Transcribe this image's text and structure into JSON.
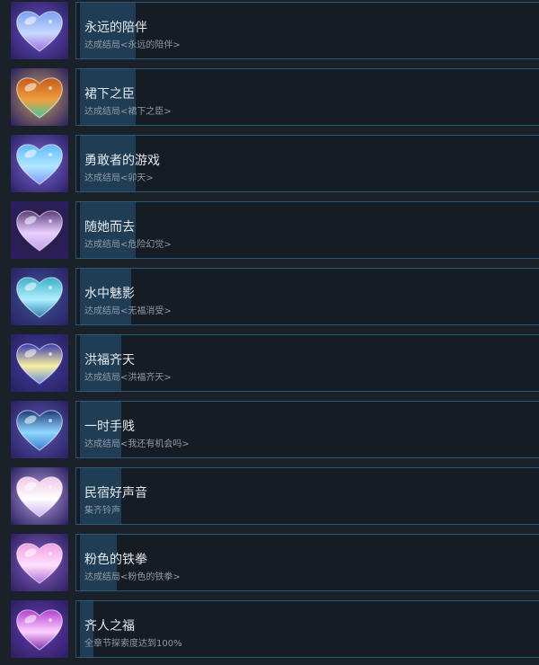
{
  "achievements": [
    {
      "title": "永远的陪伴",
      "desc": "达成结局<永远的陪伴>",
      "progress": 0.12,
      "colors": [
        "#7aa0f0",
        "#c8d8ff",
        "#a070e0",
        "#6a4fc8"
      ]
    },
    {
      "title": "裙下之臣",
      "desc": "达成结局<裙下之臣>",
      "progress": 0.12,
      "colors": [
        "#c45a1a",
        "#f0a040",
        "#40c8a0",
        "#c8a060"
      ]
    },
    {
      "title": "勇敢者的游戏",
      "desc": "达成结局<卯天>",
      "progress": 0.12,
      "colors": [
        "#60b8ff",
        "#b0e8ff",
        "#8098ff",
        "#7c6ae0"
      ]
    },
    {
      "title": "随她而去",
      "desc": "达成结局<危险幻觉>",
      "progress": 0.12,
      "colors": [
        "#5a3a7a",
        "#e8d0ff",
        "#c0a0e8",
        "#2a1a40"
      ]
    },
    {
      "title": "水中魅影",
      "desc": "达成结局<无福消受>",
      "progress": 0.11,
      "colors": [
        "#3ab0c8",
        "#b0f0ff",
        "#2a80b0",
        "#3a5aa0"
      ]
    },
    {
      "title": "洪福齐天",
      "desc": "达成结局<洪福齐天>",
      "progress": 0.09,
      "colors": [
        "#3a3ab0",
        "#f8f0a0",
        "#6a8ae0",
        "#4040a8"
      ]
    },
    {
      "title": "一时手贱",
      "desc": "达成结局<我还有机会吗>",
      "progress": 0.09,
      "colors": [
        "#1a3a78",
        "#90d8ff",
        "#3a7ad0",
        "#5a5ab8"
      ]
    },
    {
      "title": "民宿好声音",
      "desc": "集齐铃声",
      "progress": 0.09,
      "colors": [
        "#f0c8e8",
        "#ffffff",
        "#c8b0f0",
        "#b8a0e0"
      ]
    },
    {
      "title": "粉色的铁拳",
      "desc": "达成结局<粉色的铁拳>",
      "progress": 0.08,
      "colors": [
        "#f0a0e0",
        "#ffe0ff",
        "#b070d8",
        "#9060c8"
      ]
    },
    {
      "title": "齐人之福",
      "desc": "全章节探索度达到100%",
      "progress": 0.03,
      "colors": [
        "#b040d0",
        "#ffd0ff",
        "#8030b0",
        "#6a3ab8"
      ]
    }
  ]
}
